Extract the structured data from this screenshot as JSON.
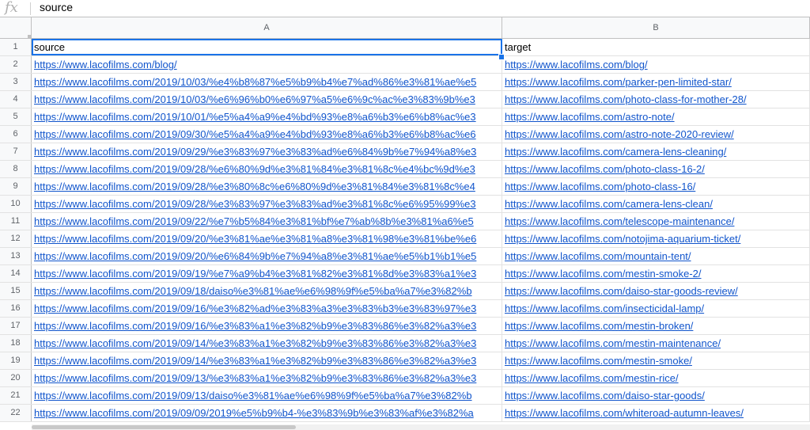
{
  "formula_bar": {
    "icon": "fx-icon",
    "value": "source"
  },
  "columns": [
    "A",
    "B"
  ],
  "rows": [
    {
      "num": "1",
      "a": "source",
      "b": "target",
      "header": true
    },
    {
      "num": "2",
      "a": "https://www.lacofilms.com/blog/",
      "b": "https://www.lacofilms.com/blog/"
    },
    {
      "num": "3",
      "a": "https://www.lacofilms.com/2019/10/03/%e4%b8%87%e5%b9%b4%e7%ad%86%e3%81%ae%e5",
      "b": "https://www.lacofilms.com/parker-pen-limited-star/"
    },
    {
      "num": "4",
      "a": "https://www.lacofilms.com/2019/10/03/%e6%96%b0%e6%97%a5%e6%9c%ac%e3%83%9b%e3",
      "b": "https://www.lacofilms.com/photo-class-for-mother-28/"
    },
    {
      "num": "5",
      "a": "https://www.lacofilms.com/2019/10/01/%e5%a4%a9%e4%bd%93%e8%a6%b3%e6%b8%ac%e3",
      "b": "https://www.lacofilms.com/astro-note/"
    },
    {
      "num": "6",
      "a": "https://www.lacofilms.com/2019/09/30/%e5%a4%a9%e4%bd%93%e8%a6%b3%e6%b8%ac%e6",
      "b": "https://www.lacofilms.com/astro-note-2020-review/"
    },
    {
      "num": "7",
      "a": "https://www.lacofilms.com/2019/09/29/%e3%83%97%e3%83%ad%e6%84%9b%e7%94%a8%e3",
      "b": "https://www.lacofilms.com/camera-lens-cleaning/"
    },
    {
      "num": "8",
      "a": "https://www.lacofilms.com/2019/09/28/%e6%80%9d%e3%81%84%e3%81%8c%e4%bc%9d%e3",
      "b": "https://www.lacofilms.com/photo-class-16-2/"
    },
    {
      "num": "9",
      "a": "https://www.lacofilms.com/2019/09/28/%e3%80%8c%e6%80%9d%e3%81%84%e3%81%8c%e4",
      "b": "https://www.lacofilms.com/photo-class-16/"
    },
    {
      "num": "10",
      "a": "https://www.lacofilms.com/2019/09/28/%e3%83%97%e3%83%ad%e3%81%8c%e6%95%99%e3",
      "b": "https://www.lacofilms.com/camera-lens-clean/"
    },
    {
      "num": "11",
      "a": "https://www.lacofilms.com/2019/09/22/%e7%b5%84%e3%81%bf%e7%ab%8b%e3%81%a6%e5",
      "b": "https://www.lacofilms.com/telescope-maintenance/"
    },
    {
      "num": "12",
      "a": "https://www.lacofilms.com/2019/09/20/%e3%81%ae%e3%81%a8%e3%81%98%e3%81%be%e6",
      "b": "https://www.lacofilms.com/notojima-aquarium-ticket/"
    },
    {
      "num": "13",
      "a": "https://www.lacofilms.com/2019/09/20/%e6%84%9b%e7%94%a8%e3%81%ae%e5%b1%b1%e5",
      "b": "https://www.lacofilms.com/mountain-tent/"
    },
    {
      "num": "14",
      "a": "https://www.lacofilms.com/2019/09/19/%e7%a9%b4%e3%81%82%e3%81%8d%e3%83%a1%e3",
      "b": "https://www.lacofilms.com/mestin-smoke-2/"
    },
    {
      "num": "15",
      "a": "https://www.lacofilms.com/2019/09/18/daiso%e3%81%ae%e6%98%9f%e5%ba%a7%e3%82%b",
      "b": "https://www.lacofilms.com/daiso-star-goods-review/"
    },
    {
      "num": "16",
      "a": "https://www.lacofilms.com/2019/09/16/%e3%82%ad%e3%83%a3%e3%83%b3%e3%83%97%e3",
      "b": "https://www.lacofilms.com/insecticidal-lamp/"
    },
    {
      "num": "17",
      "a": "https://www.lacofilms.com/2019/09/16/%e3%83%a1%e3%82%b9%e3%83%86%e3%82%a3%e3",
      "b": "https://www.lacofilms.com/mestin-broken/"
    },
    {
      "num": "18",
      "a": "https://www.lacofilms.com/2019/09/14/%e3%83%a1%e3%82%b9%e3%83%86%e3%82%a3%e3",
      "b": "https://www.lacofilms.com/mestin-maintenance/"
    },
    {
      "num": "19",
      "a": "https://www.lacofilms.com/2019/09/14/%e3%83%a1%e3%82%b9%e3%83%86%e3%82%a3%e3",
      "b": "https://www.lacofilms.com/mestin-smoke/"
    },
    {
      "num": "20",
      "a": "https://www.lacofilms.com/2019/09/13/%e3%83%a1%e3%82%b9%e3%83%86%e3%82%a3%e3",
      "b": "https://www.lacofilms.com/mestin-rice/"
    },
    {
      "num": "21",
      "a": "https://www.lacofilms.com/2019/09/13/daiso%e3%81%ae%e6%98%9f%e5%ba%a7%e3%82%b",
      "b": "https://www.lacofilms.com/daiso-star-goods/"
    },
    {
      "num": "22",
      "a": "https://www.lacofilms.com/2019/09/09/2019%e5%b9%b4-%e3%83%9b%e3%83%af%e3%82%a",
      "b": "https://www.lacofilms.com/whiteroad-autumn-leaves/"
    }
  ],
  "colors": {
    "link": "#1155cc",
    "selection": "#1a73e8",
    "header_bg": "#f8f9fa"
  }
}
